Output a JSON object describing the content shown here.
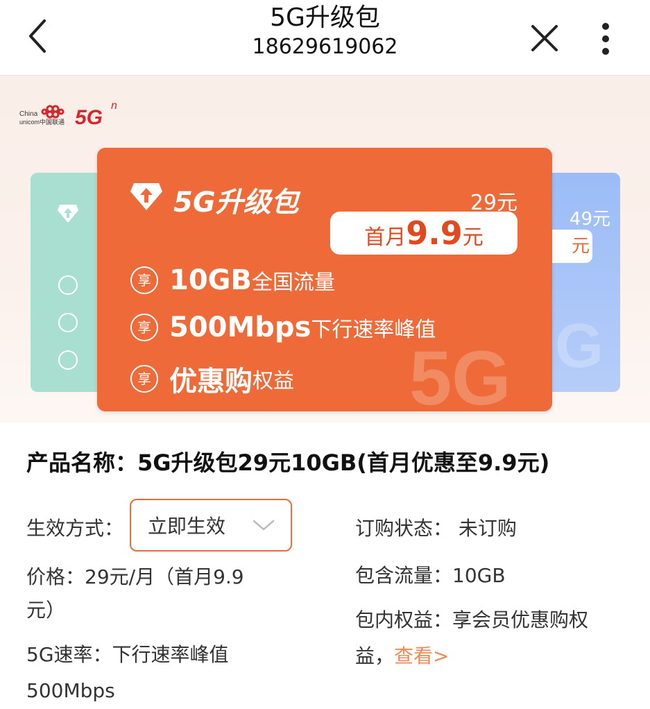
{
  "header": {
    "title": "5G升级包",
    "subtitle": "18629619062"
  },
  "brand": {
    "logo_text": "5G",
    "logo_sup": "n"
  },
  "hero": {
    "main_card": {
      "title": "5G升级包",
      "price": "29元",
      "promo_prefix": "首月",
      "promo_value": "9.9",
      "promo_suffix": "元",
      "badge_glyph": "享",
      "features": [
        {
          "highlight": "10GB",
          "text": "全国流量"
        },
        {
          "highlight": "500Mbps",
          "text": "下行速率峰值"
        },
        {
          "highlight": "优惠购",
          "text": "权益"
        }
      ]
    },
    "right_card": {
      "price": "49元",
      "promo_suffix": "元"
    }
  },
  "details": {
    "product_name": "产品名称：5G升级包29元10GB(首月优惠至9.9元)",
    "effect_label": "生效方式：",
    "effect_value": "立即生效",
    "status": "订购状态：  未订购",
    "price": "价格：29元/月（首月9.9元）",
    "flow": "包含流量：10GB",
    "benefit_text": "包内权益：享会员优惠购权益，",
    "benefit_link": "查看>",
    "speed": "5G速率：下行速率峰值500Mbps"
  },
  "colors": {
    "accent": "#ee6a38",
    "link": "#ef8a57",
    "teal_card": "#a8dfd1",
    "blue_card": "#9bbcf7",
    "brand_red": "#d6262b"
  }
}
